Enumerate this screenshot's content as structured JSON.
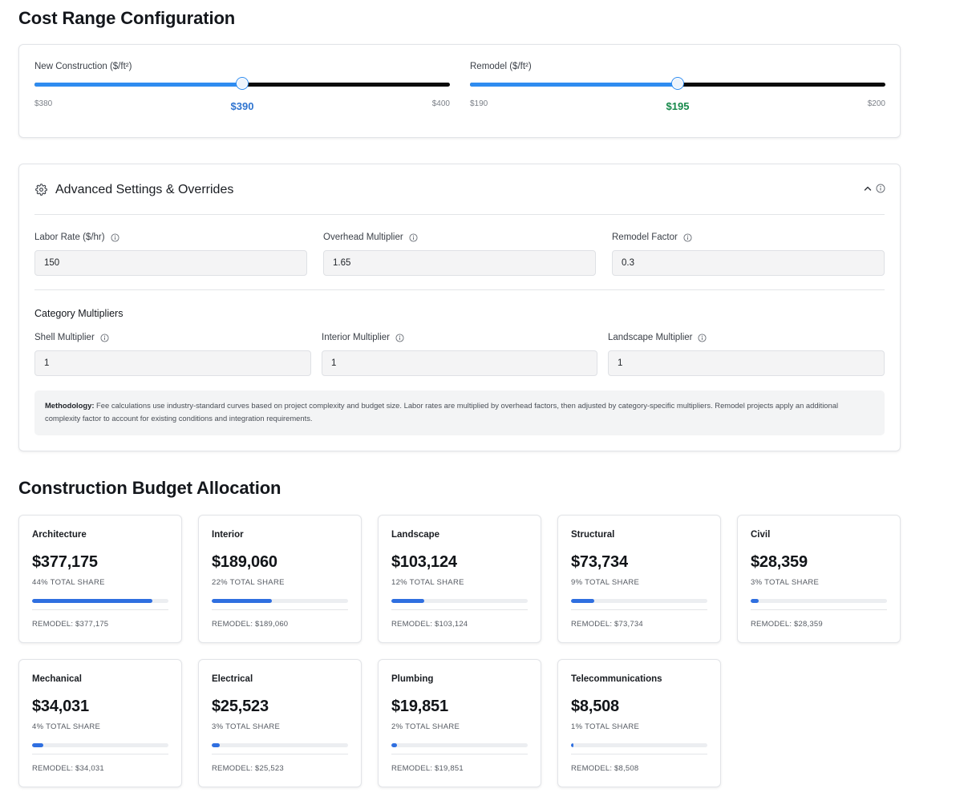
{
  "cost_range": {
    "title": "Cost Range Configuration",
    "sliders": [
      {
        "label": "New Construction ($/ft²)",
        "min_label": "$380",
        "max_label": "$400",
        "value_label": "$390",
        "fraction": 0.5,
        "value_color": "#2f74d0"
      },
      {
        "label": "Remodel ($/ft²)",
        "min_label": "$190",
        "max_label": "$200",
        "value_label": "$195",
        "fraction": 0.5,
        "value_color": "#16894a"
      }
    ]
  },
  "advanced": {
    "title": "Advanced Settings & Overrides",
    "fields": [
      {
        "label": "Labor Rate ($/hr)",
        "value": "150"
      },
      {
        "label": "Overhead Multiplier",
        "value": "1.65"
      },
      {
        "label": "Remodel Factor",
        "value": "0.3"
      }
    ],
    "category_title": "Category Multipliers",
    "category_fields": [
      {
        "label": "Shell Multiplier",
        "value": "1"
      },
      {
        "label": "Interior Multiplier",
        "value": "1"
      },
      {
        "label": "Landscape Multiplier",
        "value": "1"
      }
    ],
    "methodology_label": "Methodology:",
    "methodology_text": " Fee calculations use industry-standard curves based on project complexity and budget size. Labor rates are multiplied by overhead factors, then adjusted by category-specific multipliers. Remodel projects apply an additional complexity factor to account for existing conditions and integration requirements."
  },
  "budget": {
    "title": "Construction Budget Allocation",
    "cards": [
      {
        "name": "Architecture",
        "amount": "$377,175",
        "share": "44% TOTAL SHARE",
        "fraction": 0.88,
        "remodel": "REMODEL: $377,175"
      },
      {
        "name": "Interior",
        "amount": "$189,060",
        "share": "22% TOTAL SHARE",
        "fraction": 0.44,
        "remodel": "REMODEL: $189,060"
      },
      {
        "name": "Landscape",
        "amount": "$103,124",
        "share": "12% TOTAL SHARE",
        "fraction": 0.24,
        "remodel": "REMODEL: $103,124"
      },
      {
        "name": "Structural",
        "amount": "$73,734",
        "share": "9% TOTAL SHARE",
        "fraction": 0.17,
        "remodel": "REMODEL: $73,734"
      },
      {
        "name": "Civil",
        "amount": "$28,359",
        "share": "3% TOTAL SHARE",
        "fraction": 0.06,
        "remodel": "REMODEL: $28,359"
      },
      {
        "name": "Mechanical",
        "amount": "$34,031",
        "share": "4% TOTAL SHARE",
        "fraction": 0.08,
        "remodel": "REMODEL: $34,031"
      },
      {
        "name": "Electrical",
        "amount": "$25,523",
        "share": "3% TOTAL SHARE",
        "fraction": 0.06,
        "remodel": "REMODEL: $25,523"
      },
      {
        "name": "Plumbing",
        "amount": "$19,851",
        "share": "2% TOTAL SHARE",
        "fraction": 0.04,
        "remodel": "REMODEL: $19,851"
      },
      {
        "name": "Telecommunications",
        "amount": "$8,508",
        "share": "1% TOTAL SHARE",
        "fraction": 0.01,
        "remodel": "REMODEL: $8,508"
      }
    ]
  },
  "icons": {
    "settings": "gear-icon",
    "collapse": "chevron-up-icon",
    "info": "info-icon"
  },
  "colors": {
    "accent": "#2f8cf0",
    "bar": "#2f6fe0",
    "remodel_value": "#16894a",
    "new_value": "#2f74d0"
  }
}
